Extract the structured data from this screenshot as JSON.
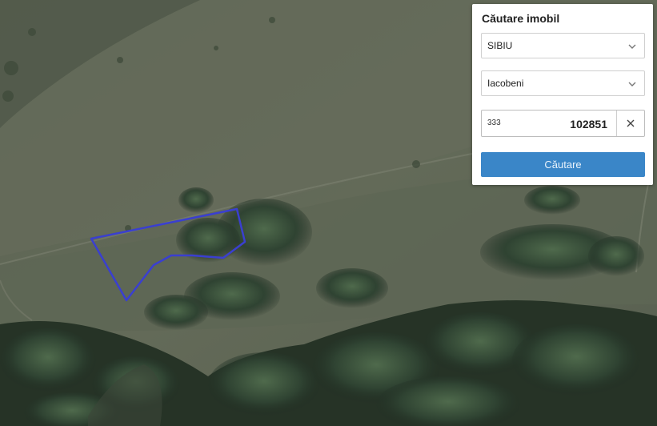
{
  "panel": {
    "title": "Căutare imobil",
    "county_value": "SIBIU",
    "locality_value": "Iacobeni",
    "id_prefix": "333",
    "id_value": "102851",
    "search_button_label": "Căutare"
  },
  "icons": {
    "county_dropdown": "chevron-down-icon",
    "locality_dropdown": "chevron-down-icon",
    "clear": "close-icon"
  },
  "colors": {
    "parcel_outline": "#3a3fd0",
    "search_button": "#3a86c8"
  }
}
